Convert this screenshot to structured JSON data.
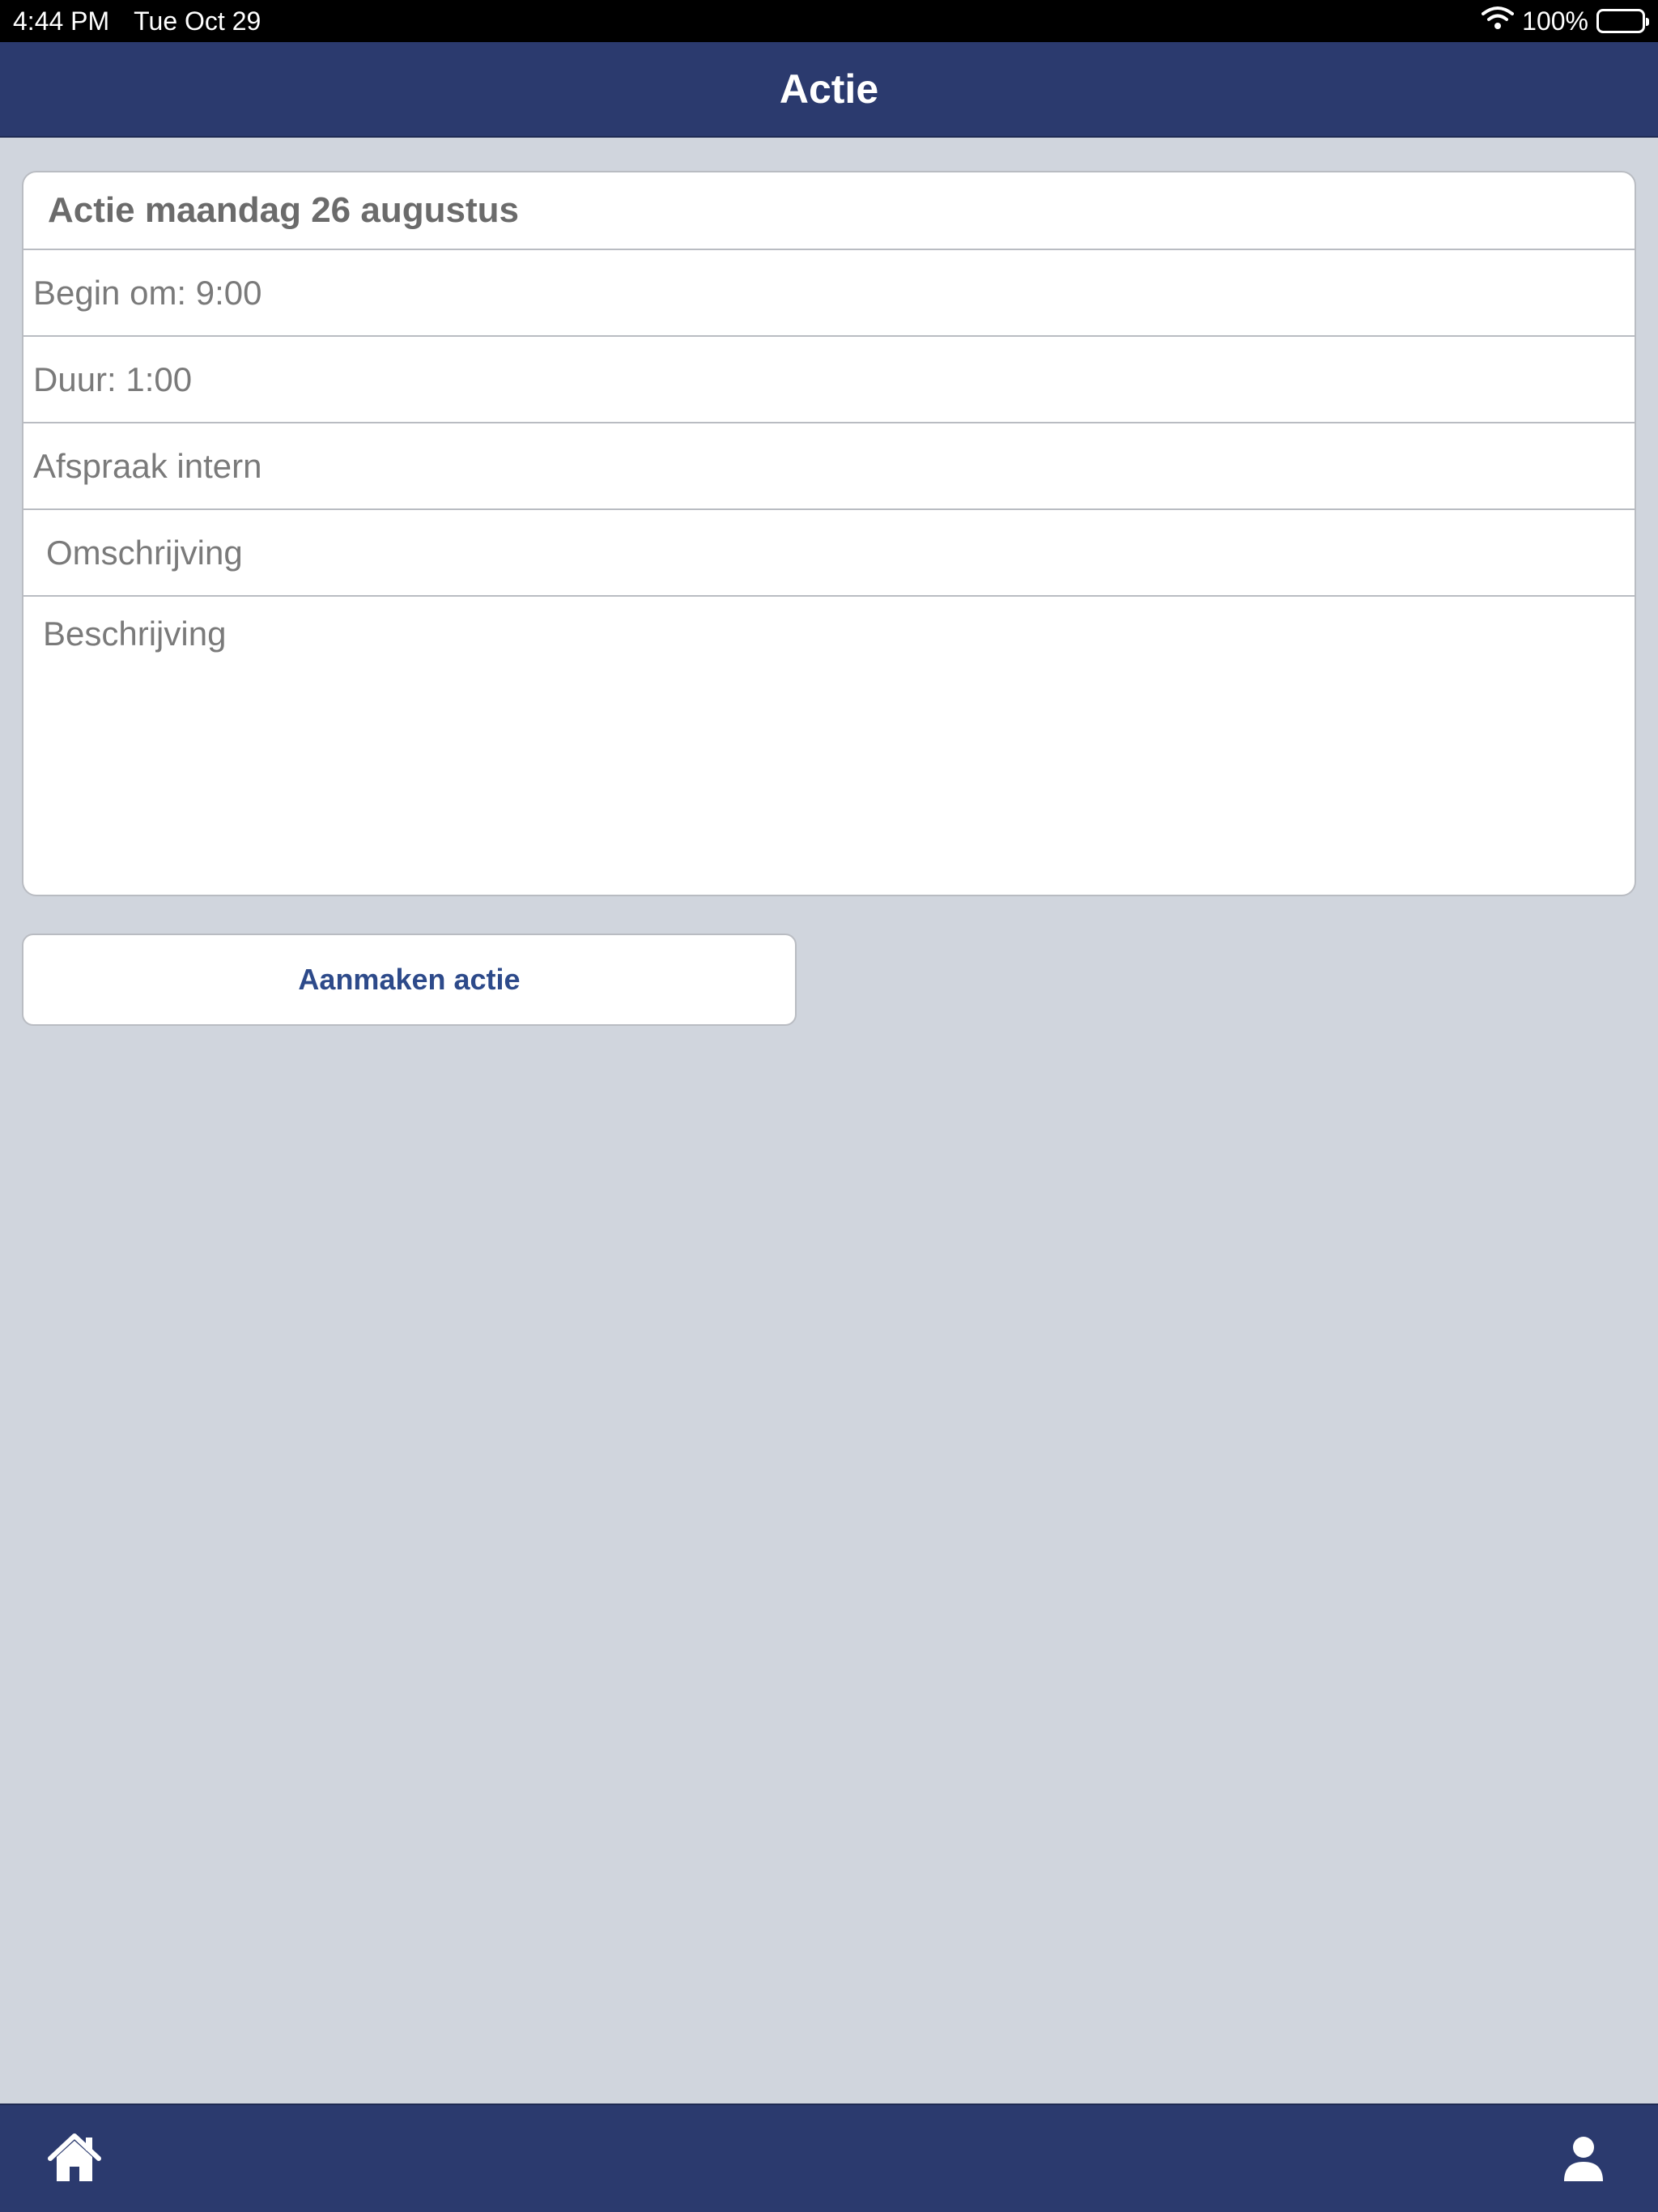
{
  "status_bar": {
    "time": "4:44 PM",
    "date": "Tue Oct 29",
    "battery": "100%"
  },
  "nav": {
    "title": "Actie"
  },
  "form": {
    "header": "Actie maandag 26 augustus",
    "begin": "Begin om: 9:00",
    "duration": "Duur: 1:00",
    "type": "Afspraak intern",
    "omschrijving_placeholder": "Omschrijving",
    "beschrijving_placeholder": "Beschrijving"
  },
  "buttons": {
    "create": "Aanmaken actie"
  },
  "tab_bar": {
    "icons": [
      "home-icon",
      "person-icon"
    ]
  },
  "colors": {
    "brand": "#2b3a6e",
    "background": "#d0d5dd",
    "button_text": "#2d4a8a"
  }
}
